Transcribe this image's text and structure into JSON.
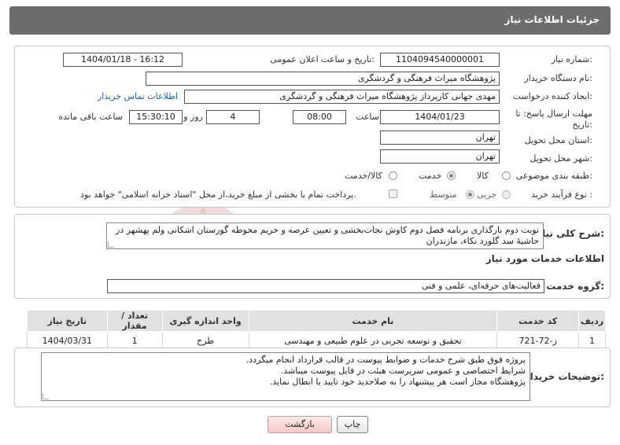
{
  "header": {
    "title": "جزئیات اطلاعات نیاز"
  },
  "need_number": {
    "label": "شماره نیاز:",
    "value": "1104094540000001"
  },
  "announce_date": {
    "label": "تاریخ و ساعت اعلان عمومی:",
    "value": "1404/01/18 - 16:12"
  },
  "buyer_org": {
    "label": "نام دستگاه خریدار:",
    "value": "پژوهشگاه میراث فرهنگی و گردشگری"
  },
  "requester": {
    "label": "ایجاد کننده درخواست:",
    "value": "مهدی جهانی کارپرداز پژوهشگاه میراث فرهنگی و گردشگری",
    "contact_link": "اطلاعات تماس خریدار"
  },
  "deadline": {
    "label_line1": "مهلت ارسال پاسخ: تا",
    "label_line2": "تاریخ:",
    "date": "1404/01/23",
    "time_label": "ساعت",
    "time": "08:00",
    "days": "4",
    "days_label": "روز و",
    "remaining": "15:30:10",
    "remaining_label": "ساعت باقی مانده"
  },
  "delivery_province": {
    "label": "استان محل تحویل:",
    "value": "تهران"
  },
  "delivery_city": {
    "label": "شهر محل تحویل:",
    "value": "تهران"
  },
  "category": {
    "label": "طبقه بندی موضوعی:",
    "options": [
      "کالا",
      "خدمت",
      "کالا/خدمت"
    ],
    "selected": "خدمت"
  },
  "purchase_type": {
    "label": "نوع فرآیند خرید :",
    "options": [
      "جزیی",
      "متوسط"
    ],
    "selected": "متوسط",
    "note": "پرداخت تمام یا بخشی از مبلغ خرید،از محل \"اسناد خزانه اسلامی\" خواهد بود."
  },
  "summary": {
    "label": "شرح کلی نیاز:",
    "text": "نوبت دوم بارگذاری برنامه فصل دوم کاوش نجات‌بخشی و تعیین عرصه و حریم محوطه گورستان اشکانی ولم پهشهر در حاشیهٔ سد گلورد نکاء، مازندران"
  },
  "services_section": {
    "title": "اطلاعات خدمات مورد نیاز"
  },
  "service_group": {
    "label": "گروه خدمت:",
    "value": "فعالیت‌های حرفه‌ای، علمی و فنی"
  },
  "table": {
    "headers": [
      "ردیف",
      "کد خدمت",
      "نام خدمت",
      "واحد اندازه گیری",
      "تعداد / مقدار",
      "تاریخ نیاز"
    ],
    "rows": [
      [
        "1",
        "ز-72-721",
        "تحقیق و توسعه تجربی در علوم طبیعی و مهندسی",
        "طرح",
        "1",
        "1404/03/31"
      ]
    ]
  },
  "buyer_notes": {
    "label": "توضیحات خریدار:",
    "lines": [
      "پروژه فوق طبق شرح خدمات و ضوابط پیوست در قالب قرارداد انجام میگردد.",
      "شرایط اختصاصی و عمومی سرپرست هیئت در فایل پیوست میباشد.",
      "پژوهشگاه مجاز است هر پیشنهاد را به صلاحدید خود تایید یا ابطال نماید."
    ]
  },
  "buttons": {
    "print": "چاپ",
    "back": "بازگشت"
  },
  "colors": {
    "header_bg": "#6d6d6d",
    "link": "#1a5fb4",
    "watermark": "#e8c9c9"
  }
}
